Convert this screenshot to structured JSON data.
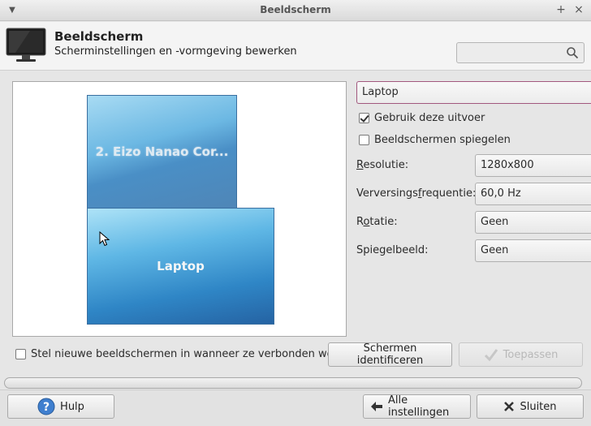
{
  "window": {
    "title": "Beeldscherm"
  },
  "header": {
    "title": "Beeldscherm",
    "subtitle": "Scherminstellingen en -vormgeving bewerken",
    "search": {
      "value": "",
      "placeholder": ""
    }
  },
  "preview": {
    "screens": [
      {
        "label": "2. Eizo Nanao Cor..."
      },
      {
        "label": "Laptop"
      }
    ]
  },
  "output": {
    "selected": "Laptop",
    "use_output": {
      "label": "Gebruik deze uitvoer",
      "checked": true
    },
    "mirror": {
      "label": "Beeldschermen spiegelen",
      "checked": false
    },
    "fields": [
      {
        "label_pre": "",
        "mnemonic": "R",
        "label_post": "esolutie:",
        "value": "1280x800"
      },
      {
        "label_pre": "Verversings",
        "mnemonic": "f",
        "label_post": "requentie:",
        "value": "60,0 Hz"
      },
      {
        "label_pre": "R",
        "mnemonic": "o",
        "label_post": "tatie:",
        "value": "Geen"
      },
      {
        "label_pre": "Spiegelbeeld:",
        "mnemonic": "",
        "label_post": "",
        "value": "Geen"
      }
    ]
  },
  "controls": {
    "auto_enable_label": "Stel nieuwe beeldschermen in wanneer ze verbonden worden",
    "identify_label": "Schermen identificeren",
    "apply_label": "Toepassen"
  },
  "footer": {
    "help_label": "Hulp",
    "all_settings_label": "Alle instellingen",
    "close_label": "Sluiten"
  },
  "colors": {
    "accent_border": "#a2587e",
    "screen_blue": "#2f86c6"
  }
}
